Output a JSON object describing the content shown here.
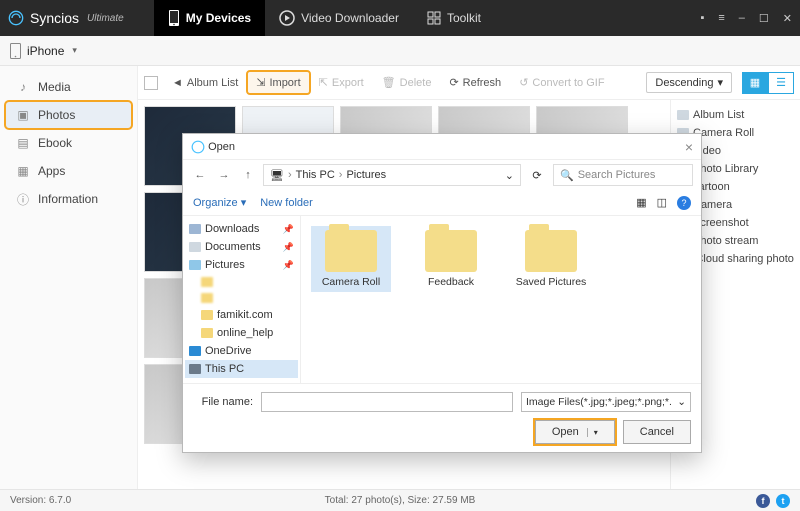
{
  "app": {
    "brand": "Syncios",
    "edition": "Ultimate"
  },
  "nav": {
    "devices": "My Devices",
    "downloader": "Video Downloader",
    "toolkit": "Toolkit"
  },
  "win_icons": {
    "msg": "▪",
    "menu": "≡",
    "min": "–",
    "max": "☐",
    "close": "✕"
  },
  "device": {
    "name": "iPhone",
    "chevron": "▾"
  },
  "sidebar": {
    "items": [
      {
        "label": "Media"
      },
      {
        "label": "Photos"
      },
      {
        "label": "Ebook"
      },
      {
        "label": "Apps"
      },
      {
        "label": "Information"
      }
    ]
  },
  "toolbar": {
    "album_list": "Album List",
    "import": "Import",
    "export": "Export",
    "delete": "Delete",
    "refresh": "Refresh",
    "convert_gif": "Convert to GIF",
    "sort": "Descending",
    "sort_chevron": "▾"
  },
  "right_tree": {
    "items": [
      "Album List",
      "Camera Roll",
      "Video",
      "Photo Library",
      "cartoon",
      "Camera",
      "Screenshot",
      "Photo stream",
      "iCloud sharing photo"
    ]
  },
  "status": {
    "version_label": "Version:",
    "version": "6.7.0",
    "summary": "Total: 27 photo(s), Size: 27.59 MB"
  },
  "dialog": {
    "title": "Open",
    "back": "←",
    "fwd": "→",
    "up": "↑",
    "breadcrumb": {
      "root_icon": "🖥",
      "root": "This PC",
      "sep": "›",
      "leaf": "Pictures",
      "drop": "⌄"
    },
    "refresh_icon": "⟳",
    "search_placeholder": "Search Pictures",
    "organize": "Organize",
    "organize_chev": "▾",
    "new_folder": "New folder",
    "view_icon": "▦",
    "preview_icon": "◫",
    "tree": [
      {
        "label": "Downloads",
        "pin": true,
        "icon": "dl"
      },
      {
        "label": "Documents",
        "pin": true,
        "icon": "doc"
      },
      {
        "label": "Pictures",
        "pin": true,
        "icon": "pic"
      },
      {
        "label": "",
        "indent": true
      },
      {
        "label": "",
        "indent": true
      },
      {
        "label": "famikit.com",
        "indent": true
      },
      {
        "label": "online_help",
        "indent": true
      },
      {
        "label": "OneDrive",
        "icon": "cloud"
      },
      {
        "label": "This PC",
        "icon": "pc",
        "selected": true
      }
    ],
    "folders": [
      {
        "name": "Camera Roll",
        "selected": true
      },
      {
        "name": "Feedback"
      },
      {
        "name": "Saved Pictures"
      }
    ],
    "file_name_label": "File name:",
    "file_name_value": "",
    "file_type": "Image Files(*.jpg;*.jpeg;*.png;*.",
    "file_type_chev": "⌄",
    "open": "Open",
    "open_chev": "▾",
    "cancel": "Cancel",
    "close_x": "×"
  }
}
